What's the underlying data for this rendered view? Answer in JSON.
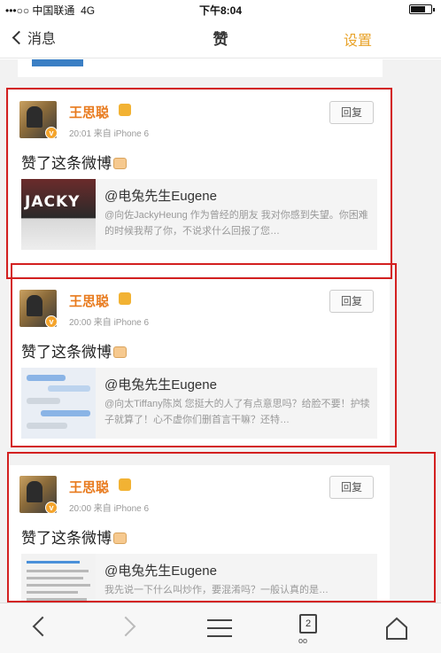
{
  "status_bar": {
    "carrier": "•••○○ 中国联通",
    "network": "4G",
    "time": "下午8:04"
  },
  "nav": {
    "back_label": "消息",
    "title": "赞",
    "settings_label": "设置"
  },
  "notifications": [
    {
      "user": "王思聪",
      "meta": "20:01  来自 iPhone 6",
      "reply_label": "回复",
      "like_text": "赞了这条微博",
      "quote_author": "@电兔先生Eugene",
      "quote_text": "@向佐JackyHeung 作为曾经的朋友 我对你感到失望。你困难的时候我帮了你，不说求什么回报了您…",
      "thumb_text": "JACKY"
    },
    {
      "user": "王思聪",
      "meta": "20:00  来自 iPhone 6",
      "reply_label": "回复",
      "like_text": "赞了这条微博",
      "quote_author": "@电兔先生Eugene",
      "quote_text": "@向太Tiffany陈岚 您挺大的人了有点意思吗？给脸不要！护犊子就算了！心不虚你们删首言干嘛？还特…"
    },
    {
      "user": "王思聪",
      "meta": "20:00  来自 iPhone 6",
      "reply_label": "回复",
      "like_text": "赞了这条微博",
      "quote_author": "@电兔先生Eugene",
      "quote_text": "我先说一下什么叫炒作，要混淆吗？一般认真的是…"
    }
  ],
  "bottom_toolbar": {
    "tabs_count": "2"
  },
  "colors": {
    "accent": "#e8a32a",
    "username": "#e87a1d",
    "highlight_border": "#d32020"
  }
}
